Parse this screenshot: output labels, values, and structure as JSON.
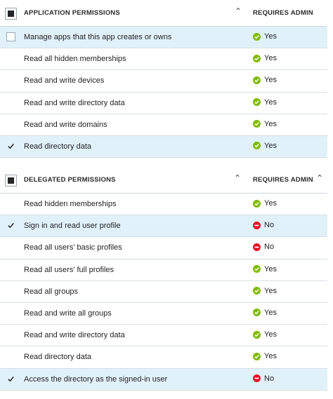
{
  "app_permissions": {
    "header": {
      "title": "APPLICATION PERMISSIONS",
      "requires_admin": "REQUIRES ADMIN"
    },
    "rows": [
      {
        "label": "Manage apps that this app creates or owns",
        "checked": false,
        "status": "Yes",
        "status_kind": "yes"
      },
      {
        "label": "Read all hidden memberships",
        "checked": null,
        "status": "Yes",
        "status_kind": "yes"
      },
      {
        "label": "Read and write devices",
        "checked": null,
        "status": "Yes",
        "status_kind": "yes"
      },
      {
        "label": "Read and write directory data",
        "checked": null,
        "status": "Yes",
        "status_kind": "yes"
      },
      {
        "label": "Read and write domains",
        "checked": null,
        "status": "Yes",
        "status_kind": "yes"
      },
      {
        "label": "Read directory data",
        "checked": true,
        "status": "Yes",
        "status_kind": "yes"
      }
    ]
  },
  "delegated_permissions": {
    "header": {
      "title": "DELEGATED PERMISSIONS",
      "requires_admin": "REQUIRES ADMIN"
    },
    "rows": [
      {
        "label": "Read hidden memberships",
        "checked": null,
        "status": "Yes",
        "status_kind": "yes"
      },
      {
        "label": "Sign in and read user profile",
        "checked": true,
        "status": "No",
        "status_kind": "no"
      },
      {
        "label": "Read all users' basic profiles",
        "checked": null,
        "status": "No",
        "status_kind": "no"
      },
      {
        "label": "Read all users' full profiles",
        "checked": null,
        "status": "Yes",
        "status_kind": "yes"
      },
      {
        "label": "Read all groups",
        "checked": null,
        "status": "Yes",
        "status_kind": "yes"
      },
      {
        "label": "Read and write all groups",
        "checked": null,
        "status": "Yes",
        "status_kind": "yes"
      },
      {
        "label": "Read and write directory data",
        "checked": null,
        "status": "Yes",
        "status_kind": "yes"
      },
      {
        "label": "Read directory data",
        "checked": null,
        "status": "Yes",
        "status_kind": "yes"
      },
      {
        "label": "Access the directory as the signed-in user",
        "checked": true,
        "status": "No",
        "status_kind": "no"
      }
    ]
  },
  "colors": {
    "yes": "#7fba00",
    "no": "#e81123",
    "selected_bg": "#e1f1fa"
  },
  "icons": {
    "yes": "check-circle-icon",
    "no": "no-entry-icon",
    "sort": "caret-up-icon"
  }
}
